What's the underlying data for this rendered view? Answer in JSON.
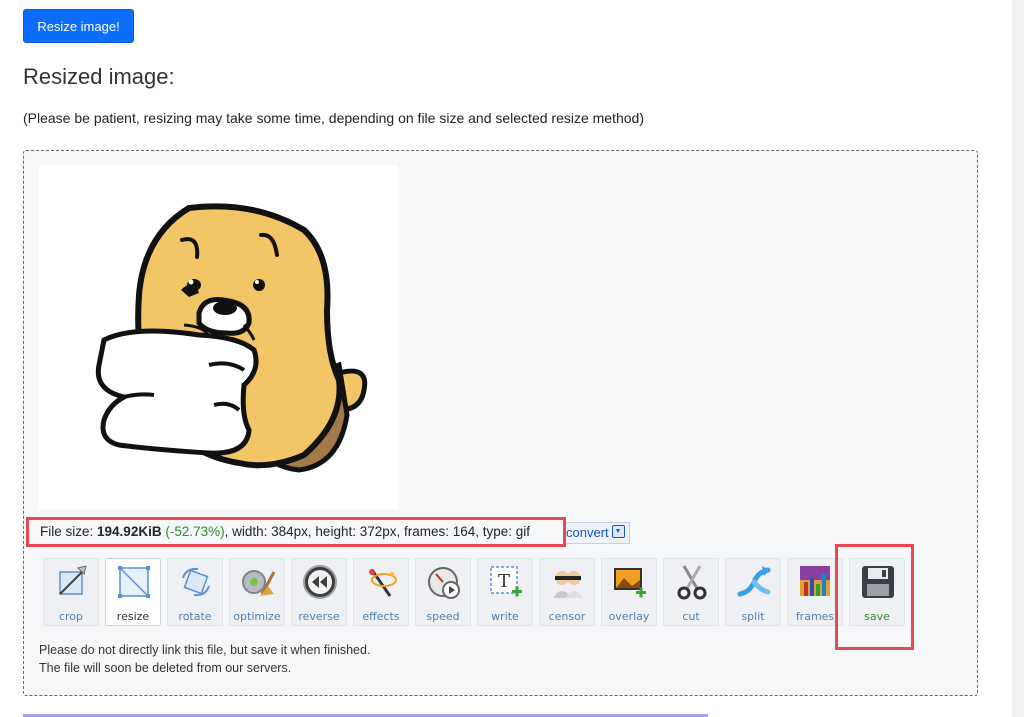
{
  "top_button": {
    "label": "Resize image!"
  },
  "section": {
    "title": "Resized image:",
    "patience_note": "(Please be patient, resizing may take some time, depending on file size and selected resize method)"
  },
  "file_info": {
    "label": "File size:",
    "size": "194.92KiB",
    "change": "(-52.73%)",
    "details": ", width: 384px, height: 372px, frames: 164, type: gif"
  },
  "convert": {
    "label": "convert",
    "icon": "download-icon"
  },
  "tools": [
    {
      "label": "crop",
      "icon": "crop-icon"
    },
    {
      "label": "resize",
      "icon": "resize-icon",
      "active": true
    },
    {
      "label": "rotate",
      "icon": "rotate-icon"
    },
    {
      "label": "optimize",
      "icon": "optimize-icon"
    },
    {
      "label": "reverse",
      "icon": "reverse-icon"
    },
    {
      "label": "effects",
      "icon": "effects-icon"
    },
    {
      "label": "speed",
      "icon": "speed-icon"
    },
    {
      "label": "write",
      "icon": "write-icon"
    },
    {
      "label": "censor",
      "icon": "censor-icon"
    },
    {
      "label": "overlay",
      "icon": "overlay-icon"
    },
    {
      "label": "cut",
      "icon": "scissors-icon"
    },
    {
      "label": "split",
      "icon": "split-icon"
    },
    {
      "label": "frames",
      "icon": "frames-icon"
    },
    {
      "label": "save",
      "icon": "floppy-disk-icon",
      "highlighted": true
    }
  ],
  "footer": {
    "line1": "Please do not directly link this file, but save it when finished.",
    "line2": "The file will soon be deleted from our servers."
  },
  "colors": {
    "primary_button": "#0d6efd",
    "highlight_border": "#e8474f",
    "percent_change": "#2e8b2e",
    "tool_label": "#4a7fb5"
  }
}
